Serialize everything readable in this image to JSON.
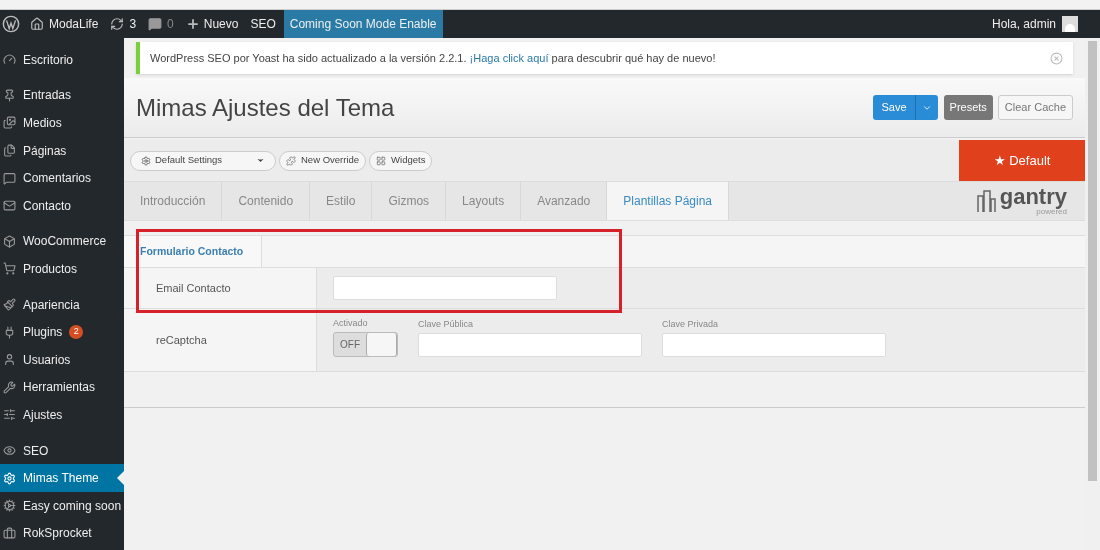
{
  "admin_bar": {
    "site": "ModaLife",
    "updates": "3",
    "comments": "0",
    "new": "Nuevo",
    "seo": "SEO",
    "coming_soon": "Coming Soon Mode Enable",
    "greeting": "Hola, admin"
  },
  "sidebar": {
    "groups": [
      {
        "items": [
          {
            "label": "Escritorio",
            "selected": false
          }
        ]
      },
      {
        "items": [
          {
            "label": "Entradas",
            "selected": false
          },
          {
            "label": "Medios",
            "selected": false
          },
          {
            "label": "Páginas",
            "selected": false
          },
          {
            "label": "Comentarios",
            "selected": false
          },
          {
            "label": "Contacto",
            "selected": false
          }
        ]
      },
      {
        "items": [
          {
            "label": "WooCommerce",
            "selected": false
          },
          {
            "label": "Productos",
            "selected": false
          }
        ]
      },
      {
        "items": [
          {
            "label": "Apariencia",
            "selected": false
          },
          {
            "label": "Plugins",
            "selected": false,
            "badge": "2"
          },
          {
            "label": "Usuarios",
            "selected": false
          },
          {
            "label": "Herramientas",
            "selected": false
          },
          {
            "label": "Ajustes",
            "selected": false
          }
        ]
      },
      {
        "items": [
          {
            "label": "SEO",
            "selected": false
          },
          {
            "label": "Mimas Theme",
            "selected": true
          },
          {
            "label": "Easy coming soon",
            "selected": false
          },
          {
            "label": "RokSprocket",
            "selected": false
          }
        ]
      }
    ]
  },
  "notice": {
    "text": "WordPress SEO por Yoast ha sido actualizado a la versión 2.2.1.",
    "link": "¡Haga click aquí",
    "after": "para descubrir qué hay de nuevo!"
  },
  "page_title": "Mimas Ajustes del Tema",
  "header_buttons": {
    "save": "Save",
    "presets": "Presets",
    "clear_cache": "Clear Cache"
  },
  "toolbar": {
    "settings": "Default Settings",
    "new_override": "New Override",
    "widgets": "Widgets",
    "default": "★ Default"
  },
  "tabs": [
    {
      "label": "Introducción",
      "selected": false
    },
    {
      "label": "Contenido",
      "selected": false
    },
    {
      "label": "Estilo",
      "selected": false
    },
    {
      "label": "Gizmos",
      "selected": false
    },
    {
      "label": "Layouts",
      "selected": false
    },
    {
      "label": "Avanzado",
      "selected": false
    },
    {
      "label": "Plantillas Página",
      "selected": true
    }
  ],
  "logo": {
    "name": "gantry",
    "tagline": "powered"
  },
  "subtabs": [
    {
      "label": "Formulario Contacto",
      "selected": true
    }
  ],
  "rows": [
    {
      "label": "Email Contacto",
      "fields": [
        {
          "kind": "text"
        }
      ]
    },
    {
      "label": "reCaptcha",
      "fields": [
        {
          "kind": "toggle",
          "label": "Activado",
          "state": "OFF",
          "on": false
        },
        {
          "kind": "text",
          "label": "Clave Pública"
        },
        {
          "kind": "text",
          "label": "Clave Privada"
        }
      ]
    }
  ]
}
